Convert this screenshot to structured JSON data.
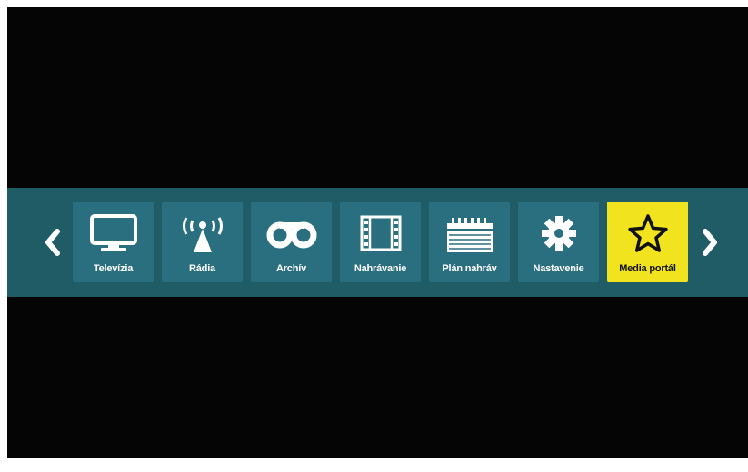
{
  "menu": {
    "prev_icon": "chevron-left-icon",
    "next_icon": "chevron-right-icon",
    "selected_index": 6,
    "colors": {
      "screen_background": "#050505",
      "band": "#1f5c66",
      "tile": "#2a6f7f",
      "selected_tile": "#f2e31f",
      "label": "#ffffff",
      "selected_label": "#111111"
    },
    "items": [
      {
        "label": "Televízia",
        "icon": "tv-icon"
      },
      {
        "label": "Rádia",
        "icon": "radio-antenna-icon"
      },
      {
        "label": "Archív",
        "icon": "tape-reels-icon"
      },
      {
        "label": "Nahrávanie",
        "icon": "film-strip-icon"
      },
      {
        "label": "Plán nahráv",
        "icon": "calendar-icon"
      },
      {
        "label": "Nastavenie",
        "icon": "gear-icon"
      },
      {
        "label": "Media portál",
        "icon": "star-icon"
      }
    ]
  }
}
